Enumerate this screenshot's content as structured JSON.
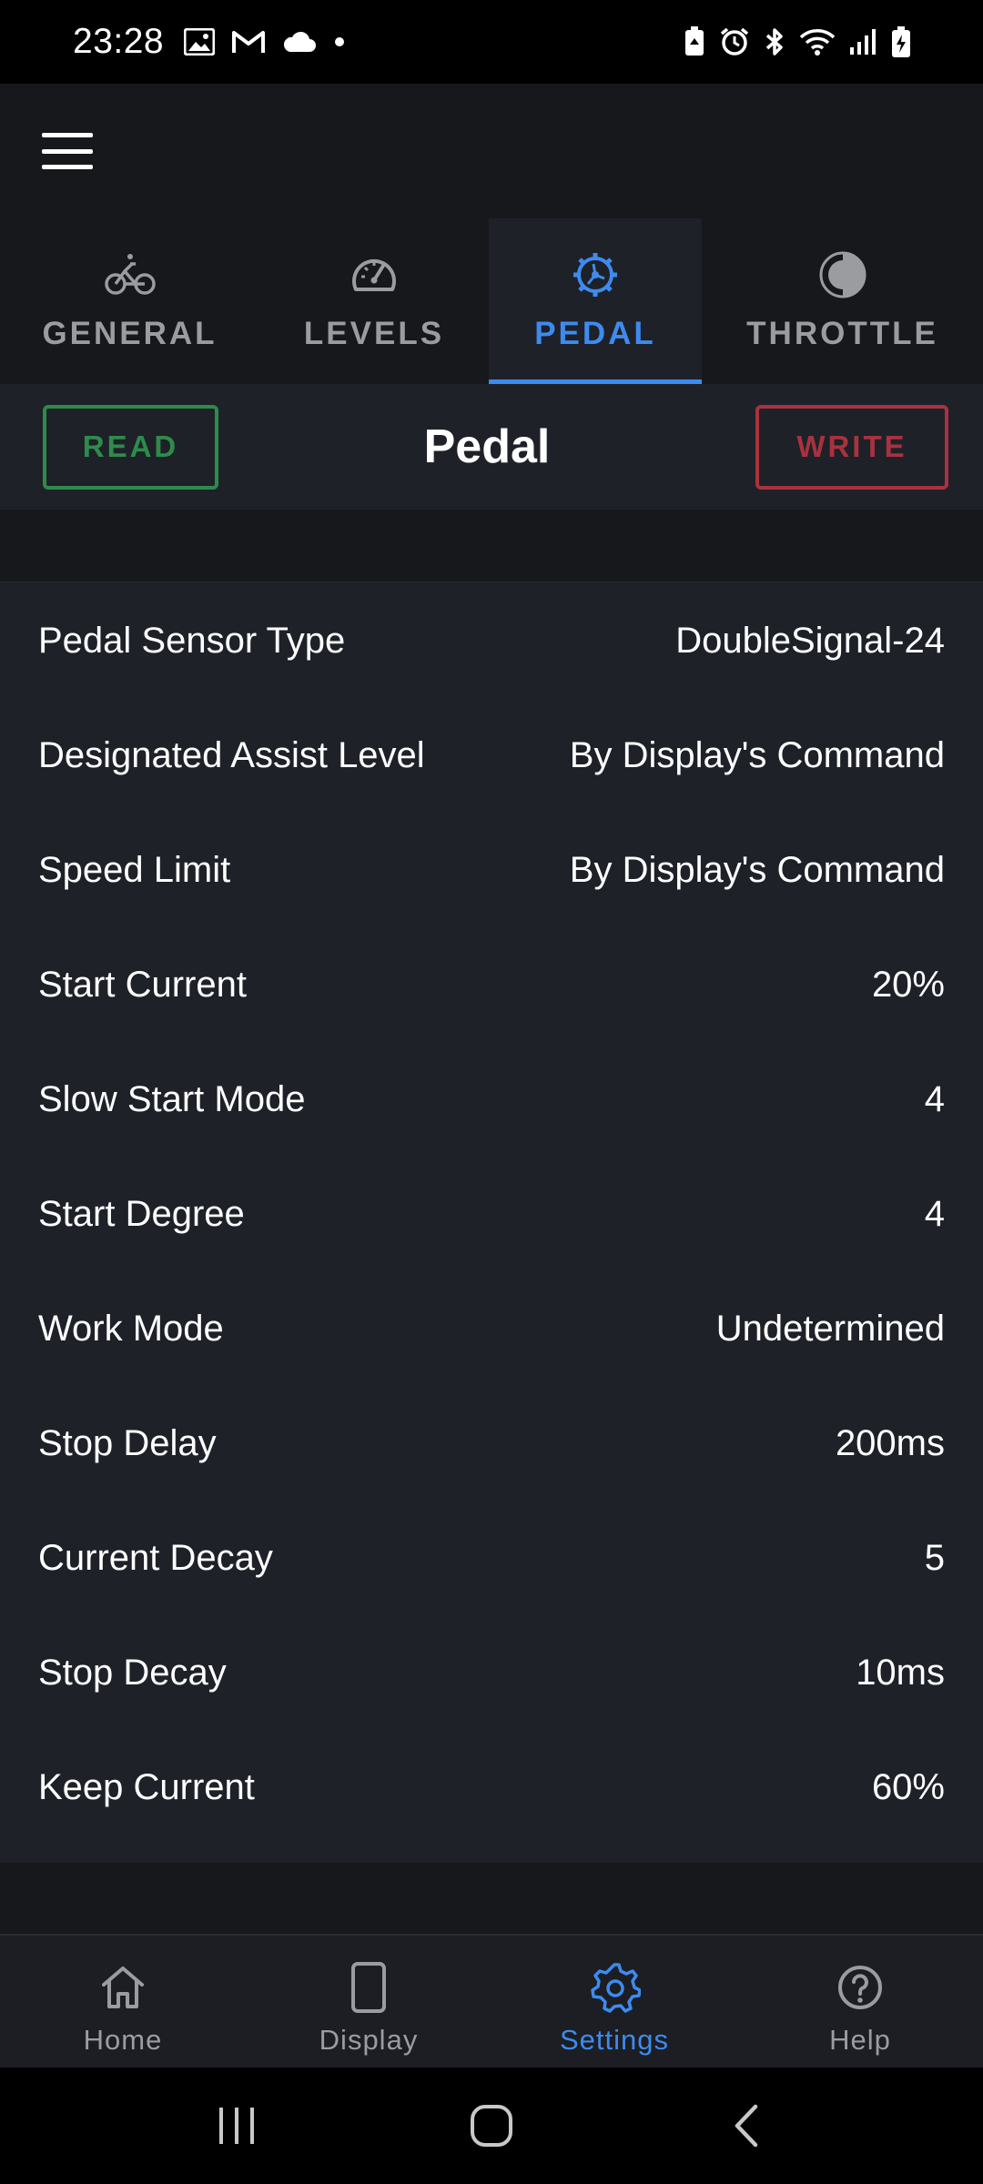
{
  "status_bar": {
    "time": "23:28",
    "left_icons": [
      "gallery-icon",
      "gmail-icon",
      "cloud-icon",
      "dot-icon"
    ],
    "right_icons": [
      "battery-saver-icon",
      "alarm-icon",
      "bluetooth-icon",
      "wifi-icon",
      "signal-icon",
      "battery-charging-icon"
    ]
  },
  "tabs": [
    {
      "label": "GENERAL",
      "icon": "bicycle-icon",
      "active": false
    },
    {
      "label": "LEVELS",
      "icon": "speedometer-icon",
      "active": false
    },
    {
      "label": "PEDAL",
      "icon": "pedal-gear-icon",
      "active": true
    },
    {
      "label": "THROTTLE",
      "icon": "half-circle-icon",
      "active": false
    }
  ],
  "header": {
    "read_label": "READ",
    "title": "Pedal",
    "write_label": "WRITE"
  },
  "settings": [
    {
      "label": "Pedal Sensor Type",
      "value": "DoubleSignal-24"
    },
    {
      "label": "Designated Assist Level",
      "value": "By Display's Command"
    },
    {
      "label": "Speed Limit",
      "value": "By Display's Command"
    },
    {
      "label": "Start Current",
      "value": "20%"
    },
    {
      "label": "Slow Start Mode",
      "value": "4"
    },
    {
      "label": "Start Degree",
      "value": "4"
    },
    {
      "label": "Work Mode",
      "value": "Undetermined"
    },
    {
      "label": "Stop Delay",
      "value": "200ms"
    },
    {
      "label": "Current Decay",
      "value": "5"
    },
    {
      "label": "Stop Decay",
      "value": "10ms"
    },
    {
      "label": "Keep Current",
      "value": "60%"
    }
  ],
  "bottom_nav": [
    {
      "label": "Home",
      "icon": "home-icon",
      "active": false
    },
    {
      "label": "Display",
      "icon": "display-icon",
      "active": false
    },
    {
      "label": "Settings",
      "icon": "settings-gear-icon",
      "active": true
    },
    {
      "label": "Help",
      "icon": "help-icon",
      "active": false
    }
  ],
  "colors": {
    "accent": "#3d8bef",
    "read": "#2e8b4c",
    "write": "#a8323f",
    "inactive": "#9a9ca0"
  }
}
